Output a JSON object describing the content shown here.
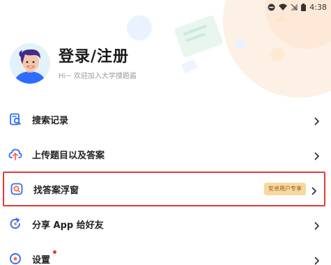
{
  "status_bar": {
    "time": "4:38"
  },
  "profile": {
    "title": "登录/注册",
    "subtitle": "Hi~ 欢迎加入大学搜题酱"
  },
  "menu": [
    {
      "label": "搜索记录",
      "icon": "search-history-icon"
    },
    {
      "label": "上传题目以及答案",
      "icon": "upload-icon"
    },
    {
      "label": "找答案浮窗",
      "icon": "floating-window-icon",
      "badge": "安卓用户专享",
      "highlighted": true
    },
    {
      "label": "分享 App 给好友",
      "icon": "share-icon"
    },
    {
      "label": "设置",
      "icon": "settings-icon",
      "has_dot": true
    }
  ],
  "colors": {
    "accent_blue": "#2f6bff",
    "highlight_border": "#e53935",
    "badge_bg": "#f6d8a0",
    "badge_text": "#9a5c12"
  }
}
